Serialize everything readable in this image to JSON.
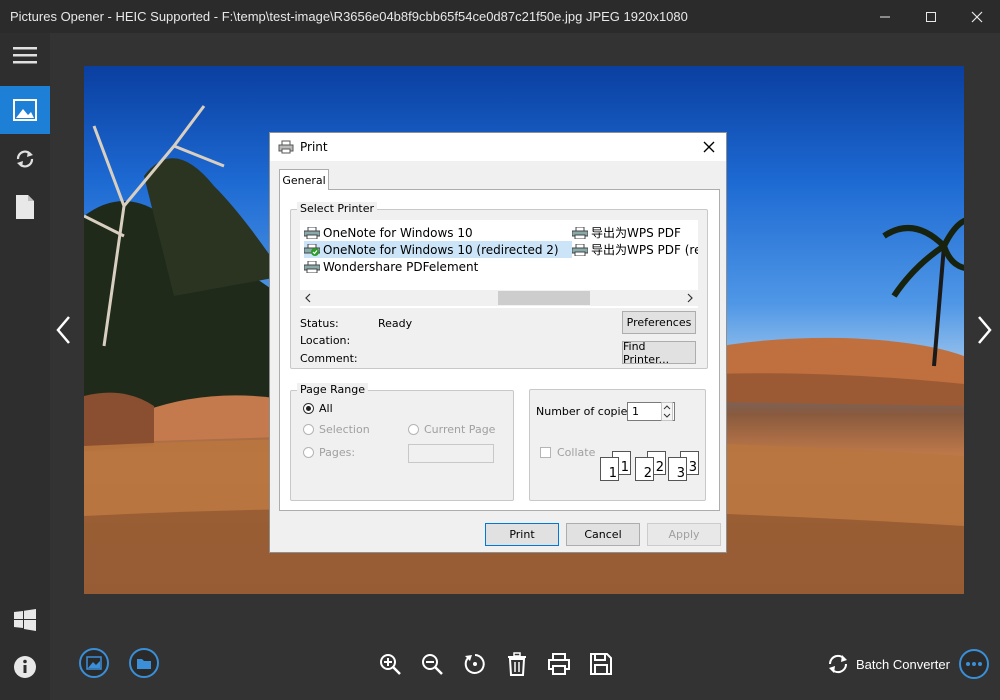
{
  "window": {
    "title": "Pictures Opener - HEIC Supported - F:\\temp\\test-image\\R3656e04b8f9cbb65f54ce0d87c21f50e.jpg JPEG 1920x1080"
  },
  "sidebar": {
    "items": [
      {
        "icon": "hamburger-icon"
      },
      {
        "icon": "image-icon",
        "active": true
      },
      {
        "icon": "rotate-icon"
      },
      {
        "icon": "document-icon"
      },
      {
        "icon": "windows-icon"
      },
      {
        "icon": "info-icon"
      }
    ]
  },
  "toolbar": {
    "tools": [
      "zoom-in-icon",
      "zoom-out-icon",
      "rotate-icon",
      "trash-icon",
      "print-icon",
      "save-icon"
    ],
    "batch_label": "Batch Converter"
  },
  "dialog": {
    "title": "Print",
    "tab": "General",
    "select_printer_label": "Select Printer",
    "printers": [
      {
        "name": "OneNote for Windows 10"
      },
      {
        "name": "OneNote for Windows 10 (redirected 2)",
        "selected": true
      },
      {
        "name": "Wondershare PDFelement"
      },
      {
        "name": "导出为WPS PDF"
      },
      {
        "name": "导出为WPS PDF (re"
      }
    ],
    "status_label": "Status:",
    "status_value": "Ready",
    "location_label": "Location:",
    "comment_label": "Comment:",
    "preferences_button": "Preferences",
    "find_printer_button": "Find Printer...",
    "page_range_label": "Page Range",
    "range_all": "All",
    "range_selection": "Selection",
    "range_current_page": "Current Page",
    "range_pages": "Pages:",
    "copies_label": "Number of copies:",
    "copies_value": "1",
    "collate_label": "Collate",
    "collate_pages": [
      "1",
      "1",
      "2",
      "2",
      "3",
      "3"
    ],
    "print_button": "Print",
    "cancel_button": "Cancel",
    "apply_button": "Apply"
  },
  "colors": {
    "accent": "#1e7fd6",
    "background": "#2b2b2b",
    "dialog_bg": "#f0f0f0",
    "selection": "#cce4f7"
  }
}
